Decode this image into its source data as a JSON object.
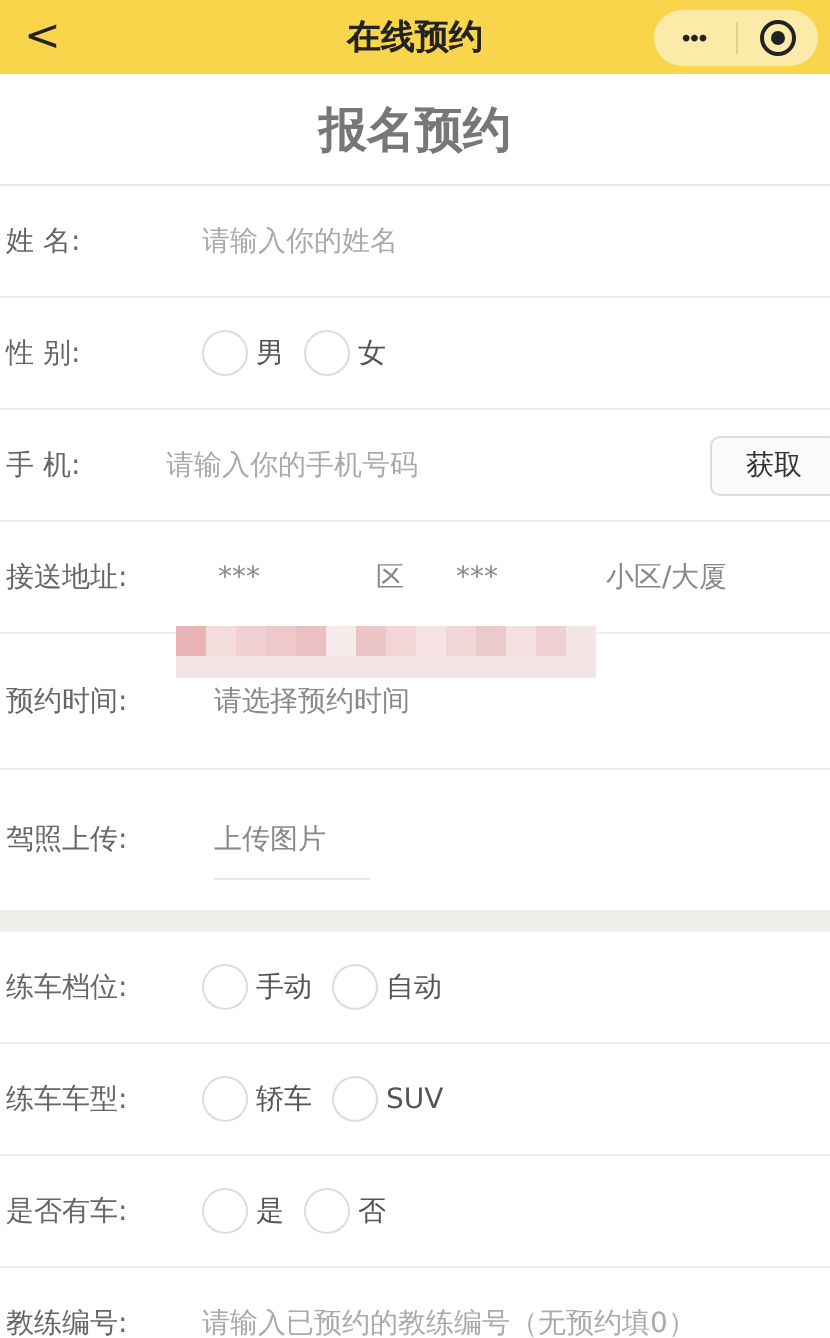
{
  "nav": {
    "back": "<",
    "title": "在线预约",
    "more": "•••"
  },
  "heading": "报名预约",
  "rows": [
    {
      "kind": "input",
      "label": "姓 名:",
      "placeholder": "请输入你的姓名"
    },
    {
      "kind": "radio",
      "label": "性 别:",
      "options": [
        {
          "label": "男",
          "selected": false
        },
        {
          "label": "女",
          "selected": false
        }
      ]
    },
    {
      "kind": "input",
      "label": "手 机:",
      "placeholder": "请输入你的手机号码",
      "button": "获取"
    },
    {
      "kind": "address",
      "label": "接送地址:",
      "parts": [
        "***",
        "区",
        "***",
        "小区/大厦"
      ]
    },
    {
      "kind": "picker",
      "label": "预约时间:",
      "value": "请选择预约时间"
    },
    {
      "kind": "upload",
      "label": "驾照上传:",
      "button": "上传图片"
    },
    {
      "kind": "gap"
    },
    {
      "kind": "radio",
      "label": "练车档位:",
      "options": [
        {
          "label": "手动",
          "selected": false
        },
        {
          "label": "自动",
          "selected": false
        }
      ]
    },
    {
      "kind": "radio",
      "label": "练车车型:",
      "options": [
        {
          "label": "轿车",
          "selected": false
        },
        {
          "label": "SUV",
          "selected": false
        }
      ]
    },
    {
      "kind": "radio",
      "label": "是否有车:",
      "options": [
        {
          "label": "是",
          "selected": false
        },
        {
          "label": "否",
          "selected": false
        }
      ]
    },
    {
      "kind": "input",
      "label": "教练编号:",
      "placeholder": "请输入已预约的教练编号（无预约填0）"
    }
  ]
}
